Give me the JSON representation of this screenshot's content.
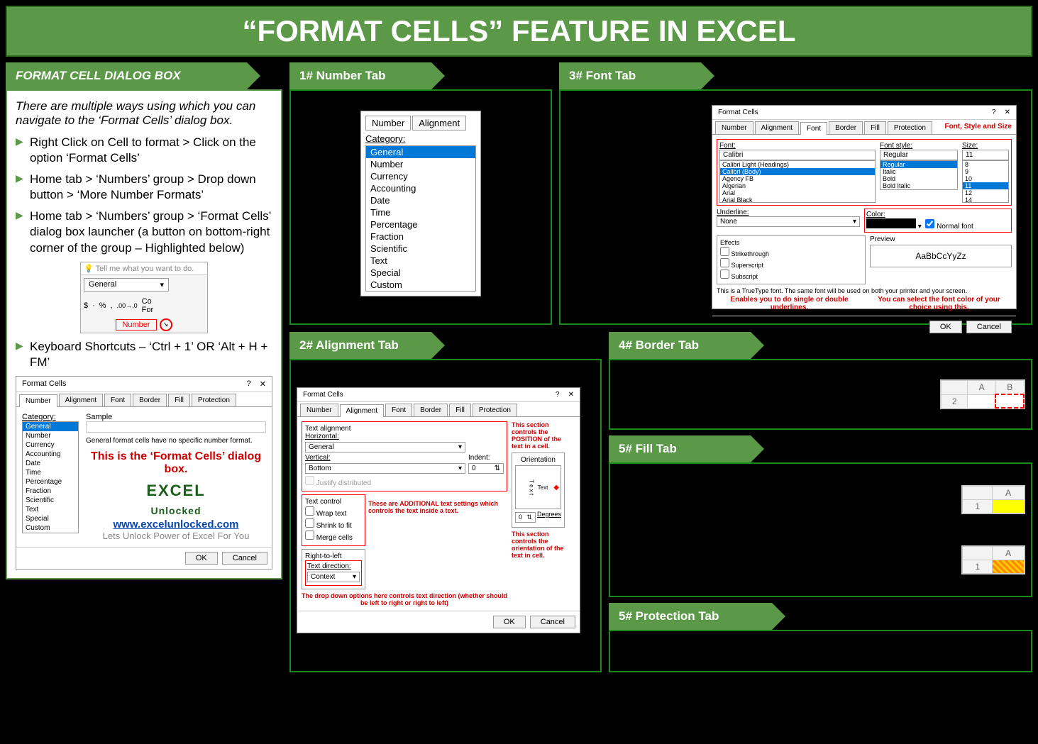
{
  "page": {
    "title": "“FORMAT CELLS” FEATURE IN EXCEL"
  },
  "sidebar": {
    "heading": "FORMAT CELL DIALOG BOX",
    "intro": "There are multiple ways using which you can navigate to the ‘Format Cells’ dialog box.",
    "bullets": [
      "Right Click on Cell to format > Click on the option ‘Format Cells’",
      "Home tab > ‘Numbers’ group > Drop down button > ‘More Number Formats’",
      "Home tab > ‘Numbers’ group > ‘Format Cells’ dialog box launcher (a button on bottom-right corner of the group – Highlighted below)",
      "Keyboard Shortcuts – ‘Ctrl + 1’ OR ‘Alt + H + FM’"
    ],
    "ribbon": {
      "tellme": "Tell me what you want to do.",
      "format": "General",
      "group_label": "Number"
    },
    "dialog": {
      "title": "Format Cells",
      "tabs": [
        "Number",
        "Alignment",
        "Font",
        "Border",
        "Fill",
        "Protection"
      ],
      "cat_label": "Category:",
      "sample_label": "Sample",
      "categories": [
        "General",
        "Number",
        "Currency",
        "Accounting",
        "Date",
        "Time",
        "Percentage",
        "Fraction",
        "Scientific",
        "Text",
        "Special",
        "Custom"
      ],
      "note": "General format cells have no specific number format.",
      "red_note": "This is the ‘Format Cells’ dialog box.",
      "logo1": "EXCEL",
      "logo2": "Unlocked",
      "url": "www.excelunlocked.com",
      "tagline": "Lets Unlock Power of Excel For You",
      "ok": "OK",
      "cancel": "Cancel"
    }
  },
  "sections": {
    "s1": {
      "label": "1# Number Tab",
      "tabs": [
        "Number",
        "Alignment"
      ],
      "cat_label": "Category:",
      "cats": [
        "General",
        "Number",
        "Currency",
        "Accounting",
        "Date",
        "Time",
        "Percentage",
        "Fraction",
        "Scientific",
        "Text",
        "Special",
        "Custom"
      ]
    },
    "s2": {
      "label": "2# Alignment Tab",
      "title": "Format Cells",
      "tabs": [
        "Number",
        "Alignment",
        "Font",
        "Border",
        "Fill",
        "Protection"
      ],
      "text_alignment": "Text alignment",
      "horizontal": "Horizontal:",
      "h_val": "General",
      "vertical": "Vertical:",
      "v_val": "Bottom",
      "indent": "Indent:",
      "indent_val": "0",
      "justify": "Justify distributed",
      "text_control": "Text control",
      "wrap": "Wrap text",
      "shrink": "Shrink to fit",
      "merge": "Merge cells",
      "rtl": "Right-to-left",
      "text_dir": "Text direction:",
      "context": "Context",
      "orientation": "Orientation",
      "text": "Text",
      "degrees": "Degrees",
      "deg_val": "0",
      "note1": "This section controls the POSITION of the text in a cell.",
      "note2": "These are ADDITIONAL text settings which controls the text inside a text.",
      "note3": "The drop down options here controls text direction (whether should be left to right or right to left)",
      "note4": "This section controls the orientation of the text in cell.",
      "ok": "OK",
      "cancel": "Cancel"
    },
    "s3": {
      "label": "3# Font Tab",
      "title": "Format Cells",
      "tabs": [
        "Number",
        "Alignment",
        "Font",
        "Border",
        "Fill",
        "Protection"
      ],
      "header_note": "Font, Style and Size",
      "font": "Font:",
      "font_val": "Calibri",
      "fonts": [
        "Calibri Light (Headings)",
        "Calibri (Body)",
        "Agency FB",
        "Algerian",
        "Arial",
        "Arial Black"
      ],
      "style": "Font style:",
      "style_val": "Regular",
      "styles": [
        "Regular",
        "Italic",
        "Bold",
        "Bold Italic"
      ],
      "size": "Size:",
      "size_val": "11",
      "sizes": [
        "8",
        "9",
        "10",
        "11",
        "12",
        "14"
      ],
      "underline": "Underline:",
      "underline_val": "None",
      "color": "Color:",
      "normal_font": "Normal font",
      "effects": "Effects",
      "strike": "Strikethrough",
      "super": "Superscript",
      "sub": "Subscript",
      "preview": "Preview",
      "preview_val": "AaBbCcYyZz",
      "truetype": "This is a TrueType font. The same font will be used on both your printer and your screen.",
      "note_left": "Enables you to do single or double underlines.",
      "note_right": "You can select the font color of your choice using this.",
      "ok": "OK",
      "cancel": "Cancel"
    },
    "s4": {
      "label": "4# Border Tab",
      "A": "A",
      "B": "B",
      "r": "2"
    },
    "s5": {
      "label": "5# Fill Tab",
      "A": "A",
      "r": "1"
    },
    "s6": {
      "label": "5# Protection Tab"
    }
  }
}
